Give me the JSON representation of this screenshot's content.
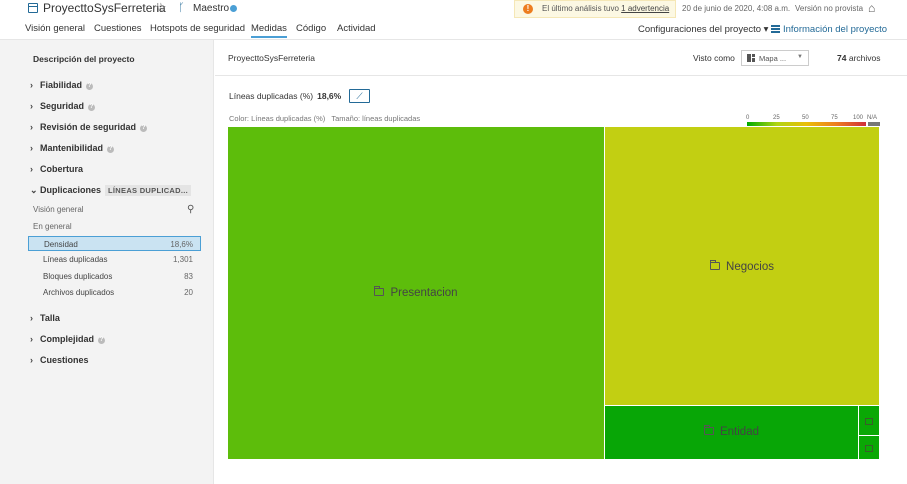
{
  "header": {
    "project_name": "ProyecttoSysFerreteria",
    "branch": "Maestro",
    "warning_prefix": "El último análisis tuvo",
    "warning_link": "1 advertencia",
    "analysis_date": "20 de junio de 2020, 4:08 a.m.",
    "version": "Versión no provista"
  },
  "nav": {
    "tabs": [
      "Visión general",
      "Cuestiones",
      "Hotspots de seguridad",
      "Medidas",
      "Código",
      "Actividad"
    ],
    "active_tab": "Medidas",
    "config_label": "Configuraciones del proyecto",
    "info_label": "Información del proyecto"
  },
  "sidebar": {
    "title": "Descripción del proyecto",
    "categories": [
      {
        "label": "Fiabilidad",
        "help": true
      },
      {
        "label": "Seguridad",
        "help": true
      },
      {
        "label": "Revisión de seguridad",
        "help": true
      },
      {
        "label": "Mantenibilidad",
        "help": true
      },
      {
        "label": "Cobertura",
        "help": false
      },
      {
        "label": "Duplicaciones",
        "help": false,
        "expanded": true,
        "tag": "LÍNEAS DUPLICAD..."
      },
      {
        "label": "Talla",
        "help": false
      },
      {
        "label": "Complejidad",
        "help": true
      },
      {
        "label": "Cuestiones",
        "help": false
      }
    ],
    "duplications": {
      "overview": "Visión general",
      "section": "En general",
      "rows": [
        {
          "label": "Densidad",
          "value": "18,6%",
          "selected": true
        },
        {
          "label": "Líneas duplicadas",
          "value": "1,301"
        },
        {
          "label": "Bloques duplicados",
          "value": "83"
        },
        {
          "label": "Archivos duplicados",
          "value": "20"
        }
      ]
    }
  },
  "main": {
    "breadcrumb": "ProyecttoSysFerreteria",
    "view_label": "Visto como",
    "view_value": "Mapa ...",
    "files_count": "74",
    "files_label": "archivos",
    "metric_label": "Líneas duplicadas (%)",
    "metric_value": "18,6%",
    "color_legend": "Color: Líneas duplicadas (%)",
    "size_legend": "Tamaño: líneas duplicadas",
    "scale_ticks": [
      "0",
      "25",
      "50",
      "75",
      "100",
      "N/A"
    ]
  },
  "treemap": {
    "tiles": [
      {
        "label": "Presentacion",
        "color": "#5dbd0b"
      },
      {
        "label": "Negocios",
        "color": "#c2cf12"
      },
      {
        "label": "Entidad",
        "color": "#08a606"
      },
      {
        "label": "",
        "color": "#0aa805",
        "icon": "file-icon"
      },
      {
        "label": "",
        "color": "#0aa805",
        "icon": "folder-icon"
      }
    ]
  }
}
